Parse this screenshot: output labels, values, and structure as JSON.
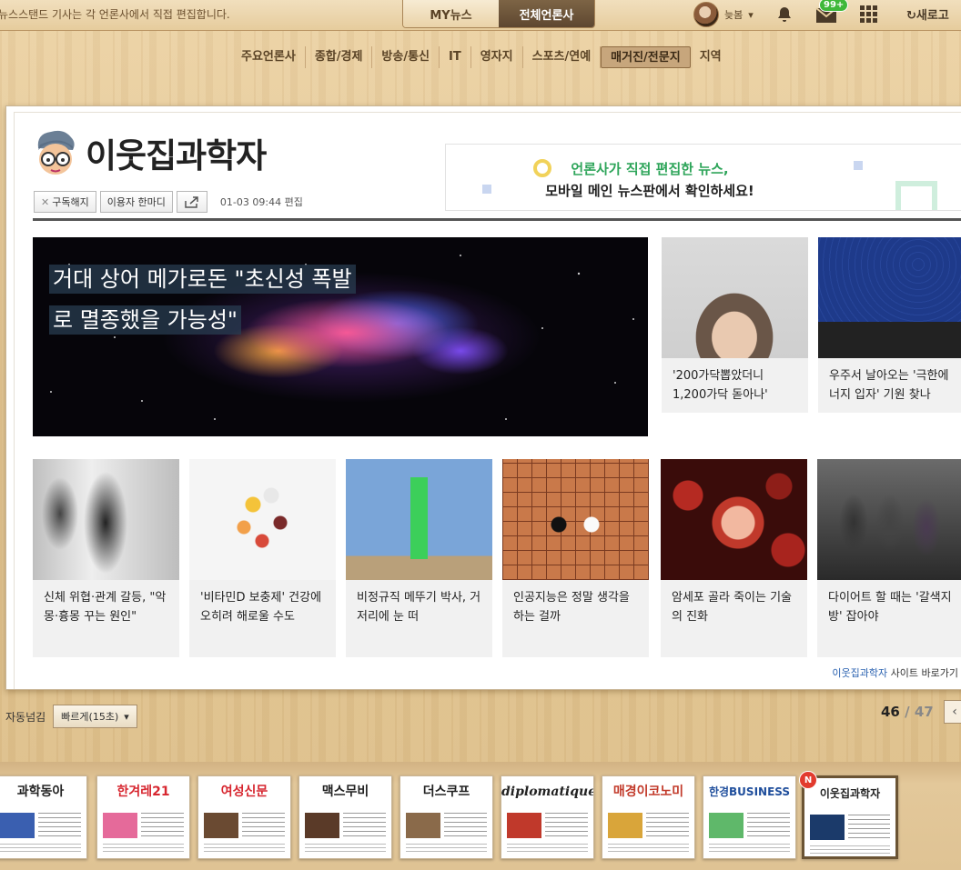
{
  "topbar": {
    "notice": "뉴스스탠드 기사는 각 언론사에서 직접 편집합니다.",
    "tabs": [
      {
        "label": "MY뉴스"
      },
      {
        "label": "전체언론사"
      }
    ],
    "user": "늦봄",
    "mail_badge": "99+",
    "refresh": "새로고"
  },
  "categories": [
    "주요언론사",
    "종합/경제",
    "방송/통신",
    "IT",
    "영자지",
    "스포츠/연예",
    "매거진/전문지",
    "지역"
  ],
  "active_category": "매거진/전문지",
  "press": {
    "name": "이웃집과학자",
    "unsubscribe": "구독해지",
    "feedback": "이용자 한마디",
    "edit_time": "01-03 09:44 편집"
  },
  "promo": {
    "line1": "언론사가 직접 편집한 뉴스,",
    "line2": "모바일 메인 뉴스판에서 확인하세요!"
  },
  "headline": {
    "line1": "거대 상어 메가로돈 \"초신성 폭발",
    "line2": "로 멸종했을 가능성\""
  },
  "side_articles": [
    {
      "title": "'200가닥뽑았더니 1,200가닥 돋아나'"
    },
    {
      "title": "우주서 날아오는 '극한에너지 입자' 기원 찾나"
    }
  ],
  "articles": [
    {
      "title": "신체 위협·관계 갈등, \"악몽·흉몽 꾸는 원인\""
    },
    {
      "title": "'비타민D 보충제' 건강에 오히려 해로울 수도"
    },
    {
      "title": "비정규직 메뚜기 박사, 거저리에 눈 떠"
    },
    {
      "title": "인공지능은 정말 생각을 하는 걸까"
    },
    {
      "title": "암세포 골라 죽이는 기술의 진화"
    },
    {
      "title": "다이어트 할 때는 '갈색지방' 잡아야"
    }
  ],
  "site_link": {
    "name": "이웃집과학자",
    "label": "사이트 바로가기"
  },
  "autoflip": {
    "label": "자동넘김",
    "speed": "빠르게(15초)"
  },
  "pager": {
    "current": "46",
    "total": "47"
  },
  "magazines": [
    {
      "name": "과학동아",
      "color": "#111"
    },
    {
      "name": "한겨레21",
      "color": "#d7262f"
    },
    {
      "name": "여성신문",
      "color": "#d7262f"
    },
    {
      "name": "맥스무비",
      "color": "#222"
    },
    {
      "name": "더스쿠프",
      "color": "#222"
    },
    {
      "name": "diplomatique",
      "color": "#111"
    },
    {
      "name": "매경이코노미",
      "color": "#c23a2a"
    },
    {
      "name": "한경BUSINESS",
      "color": "#1f4e9c"
    },
    {
      "name": "이웃집과학자",
      "color": "#222"
    }
  ],
  "new_badge": "N"
}
